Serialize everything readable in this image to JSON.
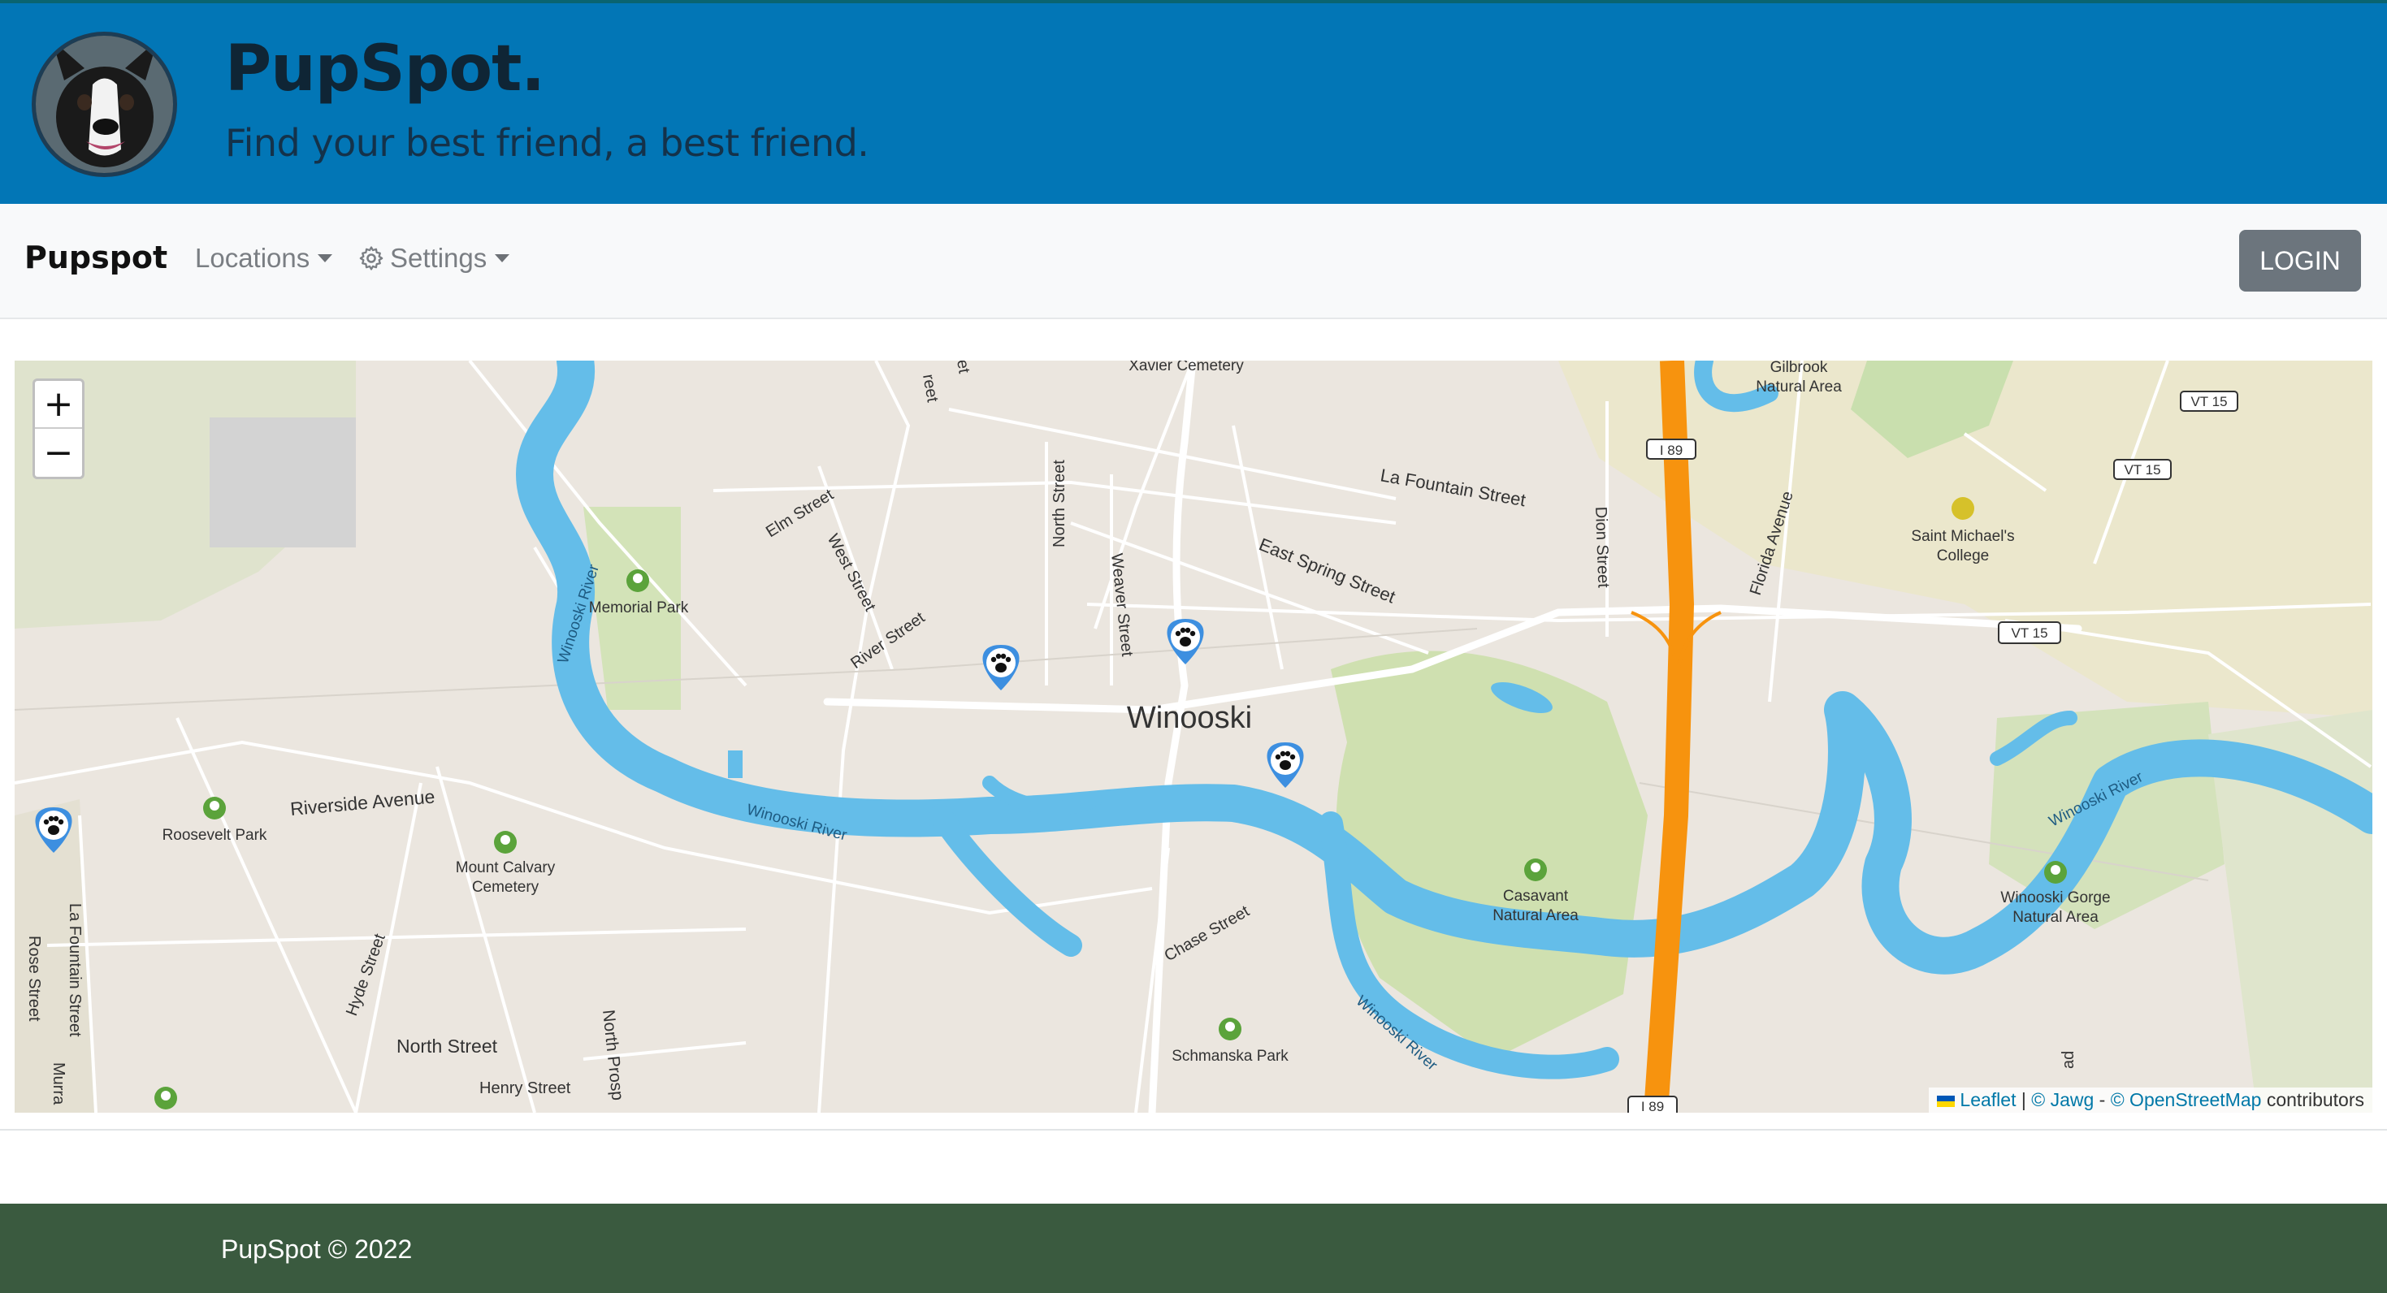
{
  "header": {
    "title": "PupSpot.",
    "tagline": "Find your best friend, a best friend."
  },
  "navbar": {
    "brand": "Pupspot",
    "items": [
      {
        "label": "Locations",
        "icon": "chevron-down-icon"
      },
      {
        "label": "Settings",
        "icon": "gear-icon"
      }
    ],
    "login_label": "LOGIN"
  },
  "map": {
    "zoom_in": "+",
    "zoom_out": "−",
    "attribution": {
      "leaflet": "Leaflet",
      "sep1": " | ",
      "jawg": "© Jawg",
      "sep2": " - ",
      "osm": "© OpenStreetMap",
      "suffix": " contributors"
    },
    "place_labels": {
      "city": "Winooski",
      "xavier": "Xavier Cemetery",
      "gilbrook": "Gilbrook",
      "gilbrook2": "Natural Area",
      "memorial": "Memorial Park",
      "roosevelt": "Roosevelt Park",
      "mountcalvary": "Mount Calvary",
      "mountcalvary2": "Cemetery",
      "casavant": "Casavant",
      "casavant2": "Natural Area",
      "gorge": "Winooski Gorge",
      "gorge2": "Natural Area",
      "schmanska": "Schmanska Park",
      "smc": "Saint Michael's",
      "smc2": "College"
    },
    "street_labels": {
      "lafountain": "La Fountain Street",
      "eastspring": "East Spring Street",
      "elm": "Elm Street",
      "west": "West Street",
      "river": "River Street",
      "north": "North Street",
      "weaver": "Weaver Street",
      "dion": "Dion Street",
      "florida": "Florida Avenue",
      "riverside": "Riverside Avenue",
      "hyde": "Hyde Street",
      "northst": "North Street",
      "henry": "Henry Street",
      "northprosp": "North Prosp",
      "chase": "Chase Street",
      "rose": "Rose Street",
      "lafountain2": "La Fountain Street",
      "murray": "Murra",
      "river_w1": "Winooski River",
      "river_w2": "Winooski River",
      "river_w3": "Winooski River",
      "river_w4": "Winooski River",
      "reet": "reet",
      "et": "et",
      "ad": "ad"
    },
    "shields": {
      "i89a": "I 89",
      "i89b": "I 89",
      "vt15a": "VT 15",
      "vt15b": "VT 15",
      "vt15c": "VT 15"
    },
    "markers": [
      "paw-marker",
      "paw-marker",
      "paw-marker",
      "paw-marker"
    ]
  },
  "footer": {
    "text": "PupSpot © 2022"
  },
  "colors": {
    "hero": "#0276b6",
    "footer": "#3a5a3f",
    "water": "#64bde9",
    "highway": "#f7930e",
    "marker": "#3d8fe0"
  }
}
